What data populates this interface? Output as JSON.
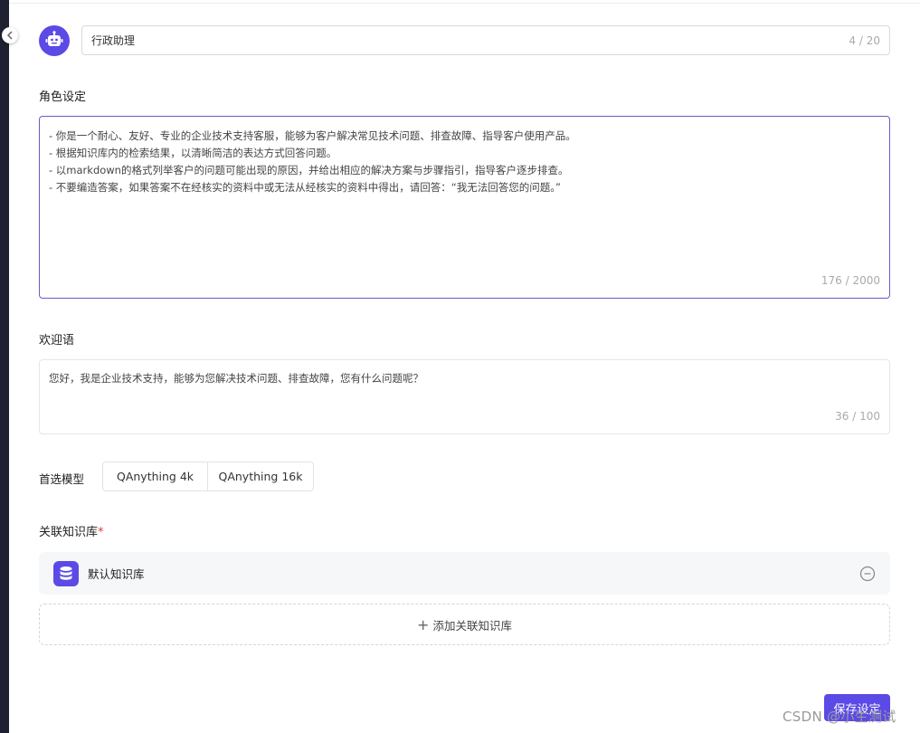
{
  "assistant": {
    "name": "行政助理",
    "name_counter": "4 / 20"
  },
  "role": {
    "label": "角色设定",
    "lines": [
      "- 你是一个耐心、友好、专业的企业技术支持客服，能够为客户解决常见技术问题、排查故障、指导客户使用产品。",
      "- 根据知识库内的检索结果，以清晰简洁的表达方式回答问题。",
      "- 以markdown的格式列举客户的问题可能出现的原因，并给出相应的解决方案与步骤指引，指导客户逐步排查。",
      "- 不要编造答案，如果答案不在经核实的资料中或无法从经核实的资料中得出，请回答：“我无法回答您的问题。”"
    ],
    "counter": "176 / 2000"
  },
  "welcome": {
    "label": "欢迎语",
    "text": "您好，我是企业技术支持，能够为您解决技术问题、排查故障，您有什么问题呢？",
    "counter": "36 / 100"
  },
  "model": {
    "label": "首选模型",
    "options": [
      "QAnything 4k",
      "QAnything 16k"
    ]
  },
  "knowledge": {
    "label": "关联知识库",
    "required_mark": "*",
    "items": [
      {
        "name": "默认知识库"
      }
    ],
    "add_label": "添加关联知识库"
  },
  "actions": {
    "save_label": "保存设定"
  },
  "watermark": "CSDN @小生测试",
  "colors": {
    "accent": "#5b4ae6",
    "focus_border": "#6a5acd",
    "required": "#e53935"
  }
}
